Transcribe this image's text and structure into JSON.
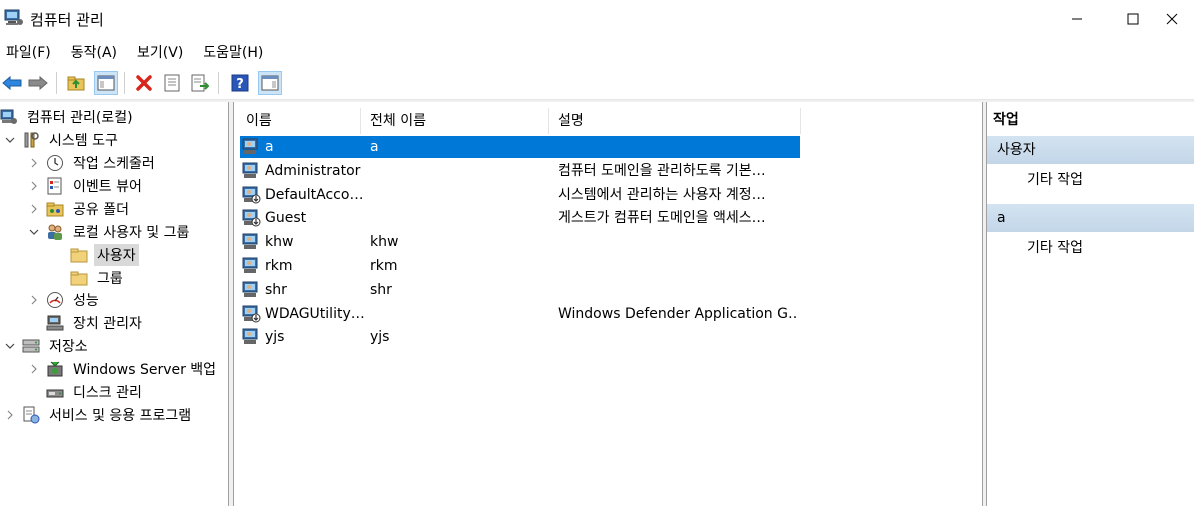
{
  "window": {
    "title": "컴퓨터 관리"
  },
  "menu": {
    "items": [
      "파일(F)",
      "동작(A)",
      "보기(V)",
      "도움말(H)"
    ]
  },
  "toolbar": {
    "buttons": [
      "back-arrow-icon",
      "forward-arrow-icon",
      "up-folder-icon",
      "show-hide-tree-icon",
      "delete-icon",
      "properties-icon",
      "export-list-icon",
      "help-icon",
      "show-hide-action-pane-icon"
    ]
  },
  "tree": {
    "root": "컴퓨터 관리(로컬)",
    "system_tools": "시스템 도구",
    "task_scheduler": "작업 스케줄러",
    "event_viewer": "이벤트 뷰어",
    "shared_folders": "공유 폴더",
    "local_users_groups": "로컬 사용자 및 그룹",
    "users": "사용자",
    "groups": "그룹",
    "performance": "성능",
    "device_manager": "장치 관리자",
    "storage": "저장소",
    "windows_server_backup": "Windows Server 백업",
    "disk_management": "디스크 관리",
    "services_apps": "서비스 및 응용 프로그램"
  },
  "list": {
    "columns": [
      "이름",
      "전체 이름",
      "설명"
    ],
    "rows": [
      {
        "name": "a",
        "full_name": "a",
        "description": ""
      },
      {
        "name": "Administrator",
        "full_name": "",
        "description": "컴퓨터 도메인을 관리하도록 기본…"
      },
      {
        "name": "DefaultAcco…",
        "full_name": "",
        "description": "시스템에서 관리하는 사용자 계정…"
      },
      {
        "name": "Guest",
        "full_name": "",
        "description": "게스트가 컴퓨터 도메인을 액세스…"
      },
      {
        "name": "khw",
        "full_name": "khw",
        "description": ""
      },
      {
        "name": "rkm",
        "full_name": "rkm",
        "description": ""
      },
      {
        "name": "shr",
        "full_name": "shr",
        "description": ""
      },
      {
        "name": "WDAGUtility…",
        "full_name": "",
        "description": "Windows Defender Application G…"
      },
      {
        "name": "yjs",
        "full_name": "yjs",
        "description": ""
      }
    ]
  },
  "actions": {
    "header": "작업",
    "section1": "사용자",
    "section1_item": "기타 작업",
    "section2": "a",
    "section2_item": "기타 작업"
  },
  "colors": {
    "selection": "#0078d7",
    "section_bg": "#c8dbed"
  }
}
